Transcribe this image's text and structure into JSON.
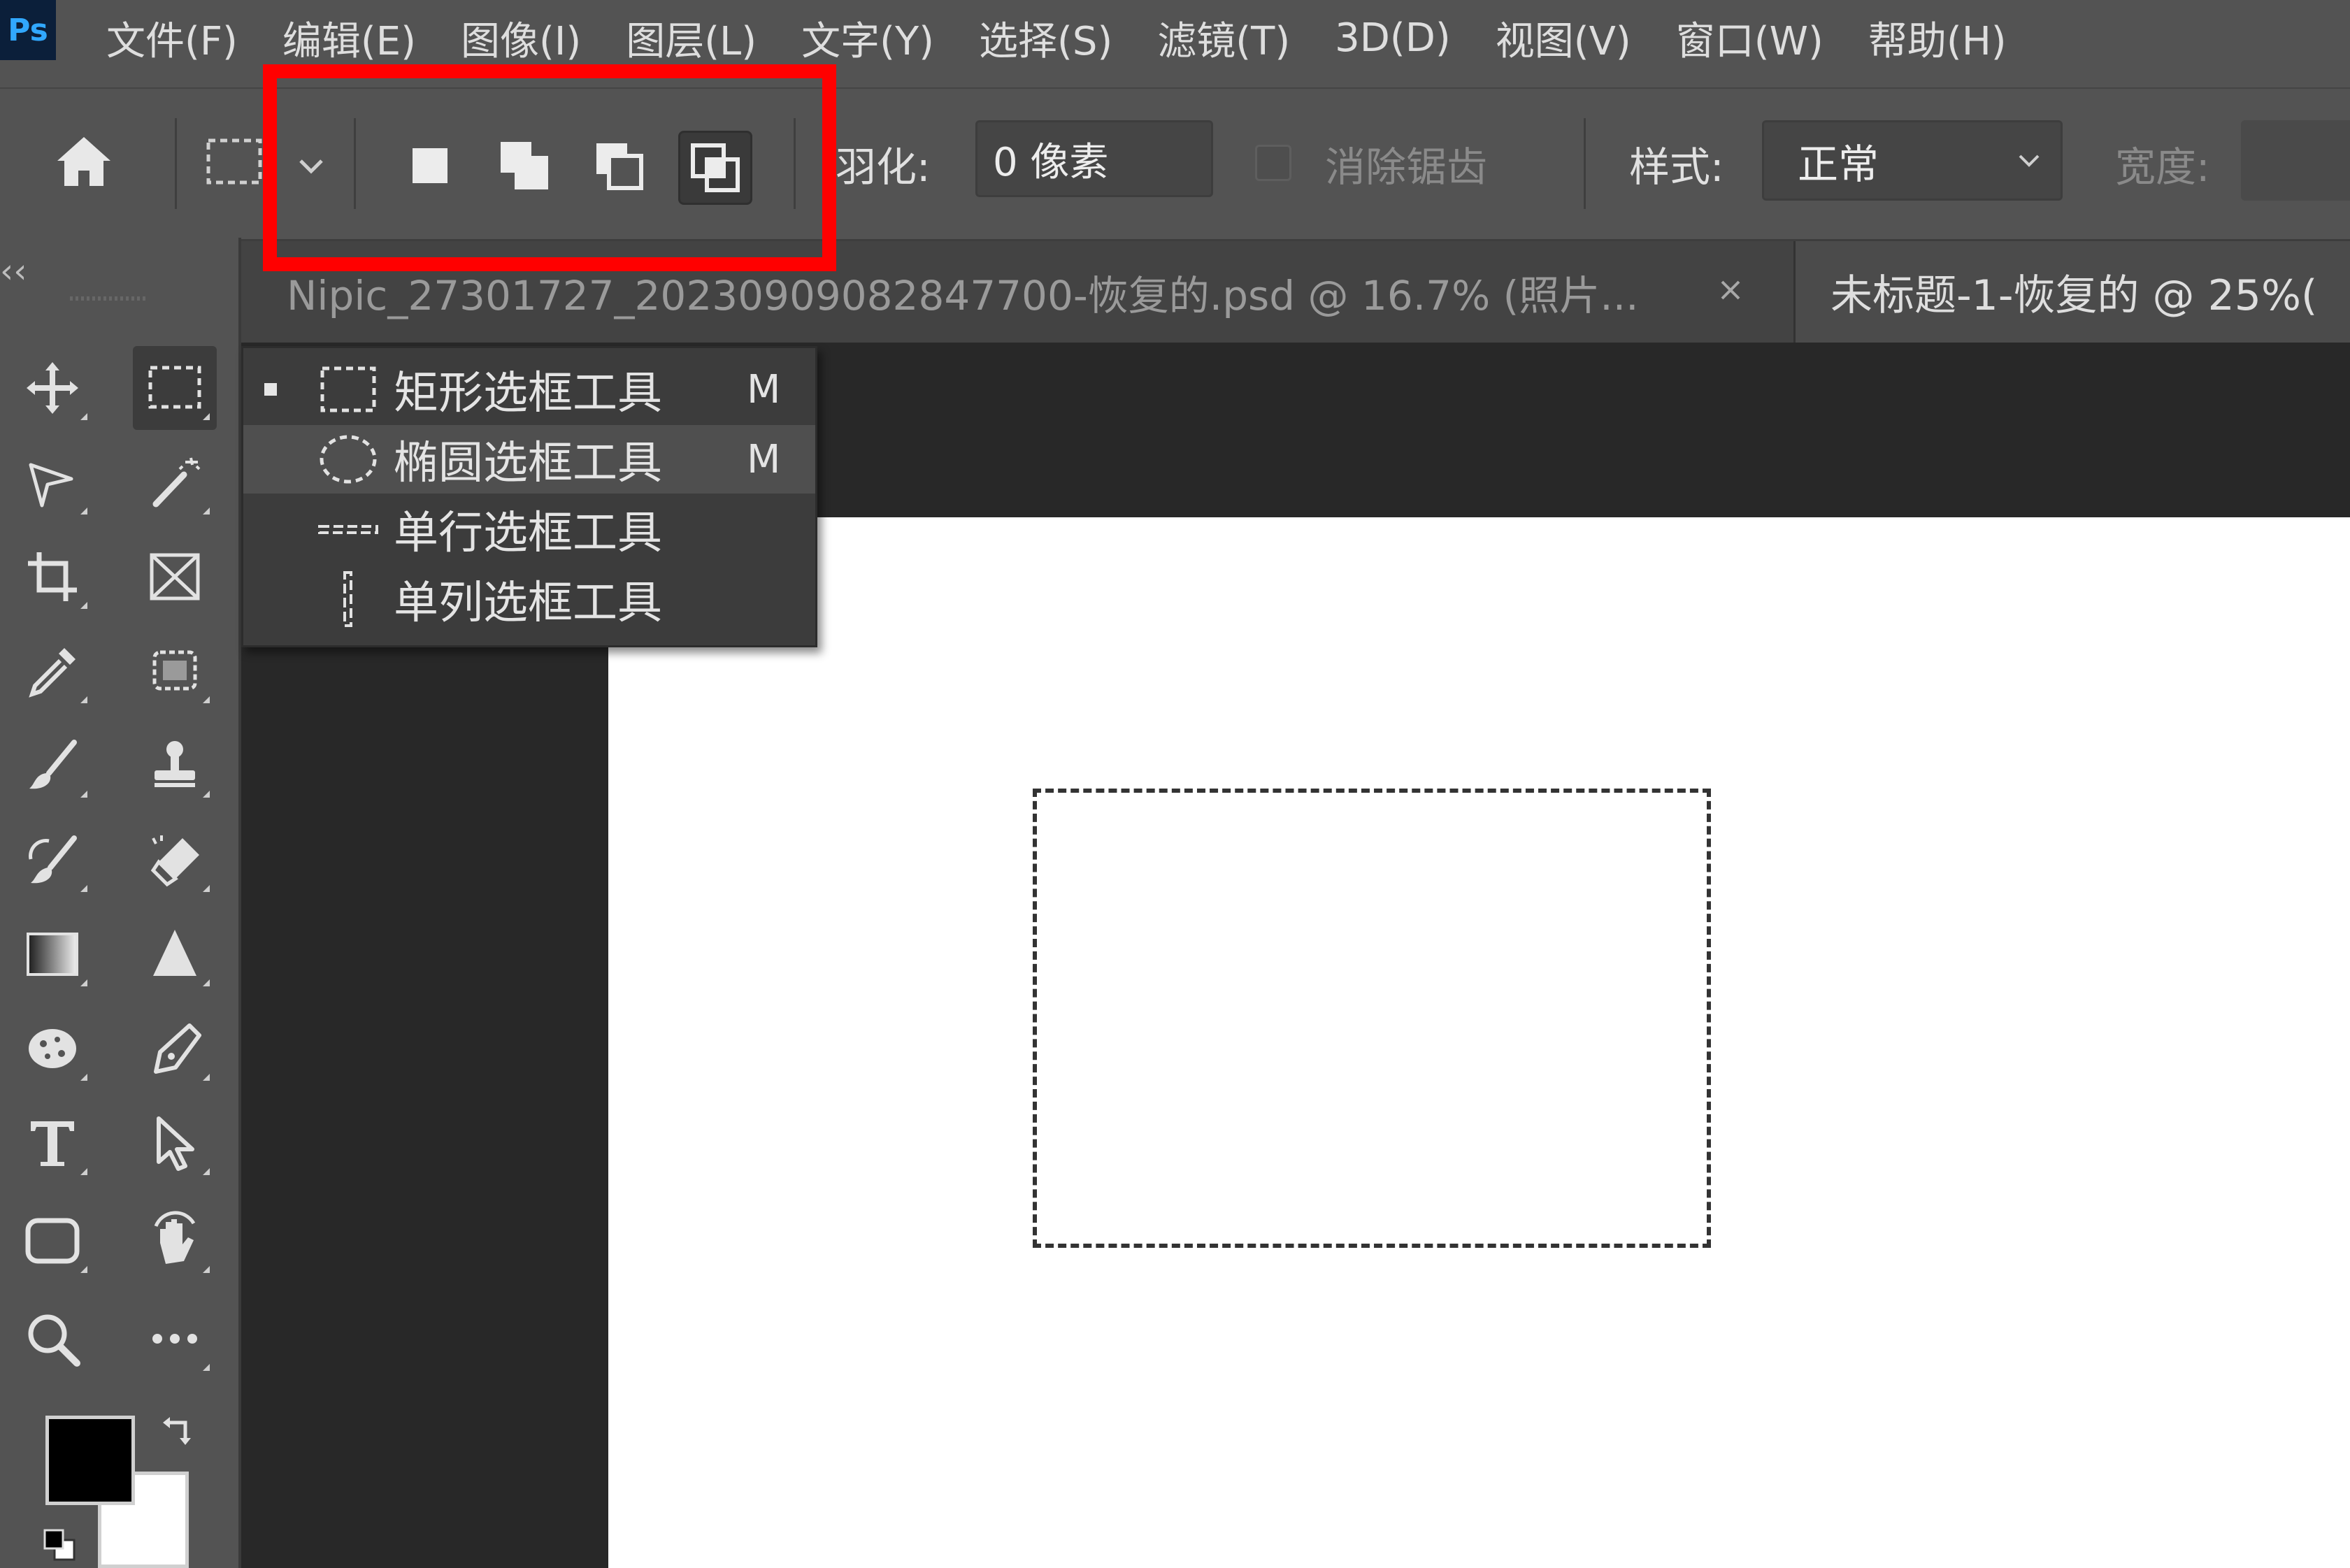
{
  "app": {
    "logo": "Ps"
  },
  "menu": [
    "文件(F)",
    "编辑(E)",
    "图像(I)",
    "图层(L)",
    "文字(Y)",
    "选择(S)",
    "滤镜(T)",
    "3D(D)",
    "视图(V)",
    "窗口(W)",
    "帮助(H)"
  ],
  "options": {
    "home_icon": "home-icon",
    "selection_modes": [
      {
        "name": "new-selection-icon",
        "active": false
      },
      {
        "name": "add-to-selection-icon",
        "active": false
      },
      {
        "name": "subtract-from-selection-icon",
        "active": false
      },
      {
        "name": "intersect-with-selection-icon",
        "active": true
      }
    ],
    "feather_label": "羽化:",
    "feather_value": "0 像素",
    "antialias_label": "消除锯齿",
    "style_label": "样式:",
    "style_value": "正常",
    "width_label": "宽度:"
  },
  "tabs": [
    {
      "title": "Nipic_27301727_20230909082847700-恢复的.psd @ 16.7% (照片...",
      "active": false
    },
    {
      "title": "未标题-1-恢复的 @ 25%(",
      "active": true
    }
  ],
  "toolbar": {
    "collapse": "‹‹",
    "tools": [
      "move-tool-icon",
      "rectangular-marquee-tool-icon",
      "lasso-tool-icon",
      "magic-wand-tool-icon",
      "crop-tool-icon",
      "frame-tool-icon",
      "eyedropper-tool-icon",
      "object-selection-tool-icon",
      "brush-tool-icon",
      "clone-stamp-tool-icon",
      "history-brush-tool-icon",
      "eraser-tool-icon",
      "gradient-tool-icon",
      "blur-tool-icon",
      "sponge-tool-icon",
      "pen-tool-icon",
      "type-tool-icon",
      "path-selection-tool-icon",
      "rectangle-tool-icon",
      "hand-tool-icon",
      "zoom-tool-icon",
      "more-tools-icon"
    ],
    "foreground_color": "#000000",
    "background_color": "#ffffff"
  },
  "flyout": [
    {
      "label": "矩形选框工具",
      "shortcut": "M",
      "current": true,
      "hover": false,
      "icon": "rectangular-marquee-icon"
    },
    {
      "label": "椭圆选框工具",
      "shortcut": "M",
      "current": false,
      "hover": true,
      "icon": "elliptical-marquee-icon"
    },
    {
      "label": "单行选框工具",
      "shortcut": "",
      "current": false,
      "hover": false,
      "icon": "single-row-marquee-icon"
    },
    {
      "label": "单列选框工具",
      "shortcut": "",
      "current": false,
      "hover": false,
      "icon": "single-column-marquee-icon"
    }
  ],
  "colors": {
    "highlight": "#ff0000",
    "ui_bg": "#535353",
    "workspace_bg": "#282828"
  }
}
